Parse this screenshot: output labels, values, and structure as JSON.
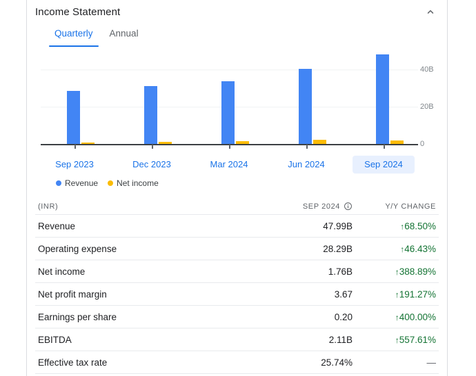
{
  "header": {
    "title": "Income Statement",
    "collapse_icon": "chevron-up-icon"
  },
  "tabs": [
    {
      "label": "Quarterly",
      "active": true
    },
    {
      "label": "Annual",
      "active": false
    }
  ],
  "legend": [
    {
      "label": "Revenue",
      "color": "#4285f4"
    },
    {
      "label": "Net income",
      "color": "#fbbc04"
    }
  ],
  "chart_data": {
    "type": "bar",
    "title": "Income Statement",
    "xlabel": "",
    "ylabel": "",
    "categories": [
      "Sep 2023",
      "Dec 2023",
      "Mar 2024",
      "Jun 2024",
      "Sep 2024"
    ],
    "selected_category": "Sep 2024",
    "series": [
      {
        "name": "Revenue",
        "color": "#4285f4",
        "values": [
          28.48,
          31.15,
          33.53,
          40.4,
          47.99
        ]
      },
      {
        "name": "Net income",
        "color": "#fbbc04",
        "values": [
          0.36,
          1.2,
          1.35,
          2.1,
          1.76
        ]
      }
    ],
    "ylim": [
      0,
      48
    ],
    "yticks": [
      0,
      20,
      40
    ],
    "ytick_labels": [
      "0",
      "20B",
      "40B"
    ],
    "grid": true,
    "legend_position": "bottom-left",
    "units": "INR"
  },
  "table": {
    "columns": [
      "(INR)",
      "SEP 2024",
      "Y/Y CHANGE"
    ],
    "info_icon": "info-icon",
    "rows": [
      {
        "label": "Revenue",
        "value": "47.99B",
        "change": "68.50%",
        "dir": "up"
      },
      {
        "label": "Operating expense",
        "value": "28.29B",
        "change": "46.43%",
        "dir": "up"
      },
      {
        "label": "Net income",
        "value": "1.76B",
        "change": "388.89%",
        "dir": "up"
      },
      {
        "label": "Net profit margin",
        "value": "3.67",
        "change": "191.27%",
        "dir": "up"
      },
      {
        "label": "Earnings per share",
        "value": "0.20",
        "change": "400.00%",
        "dir": "up"
      },
      {
        "label": "EBITDA",
        "value": "2.11B",
        "change": "557.61%",
        "dir": "up"
      },
      {
        "label": "Effective tax rate",
        "value": "25.74%",
        "change": "—",
        "dir": "none"
      }
    ]
  },
  "colors": {
    "accent": "#1a73e8",
    "revenue": "#4285f4",
    "net_income": "#fbbc04",
    "positive": "#137333",
    "selected_bg": "#e8f0fe"
  }
}
